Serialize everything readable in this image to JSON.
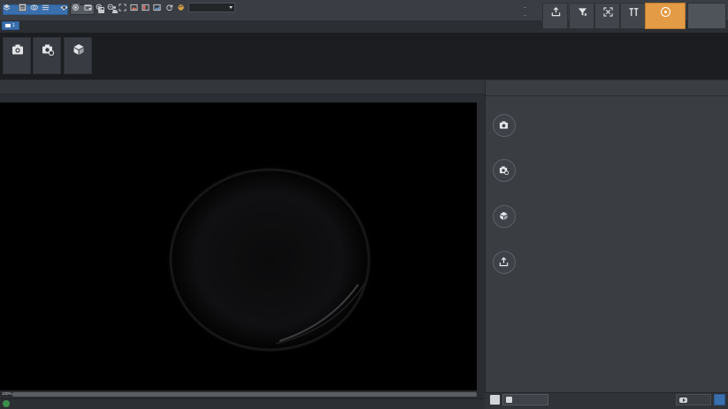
{
  "window": {
    "model_combo": "",
    "mode_combo": "",
    "user_path": ""
  },
  "timing": {
    "detect_label": "",
    "detect_value": "--",
    "output_label": "",
    "output_value": "--"
  },
  "toolbar": {
    "buttons": [
      {
        "label": "",
        "icon": "export-icon"
      },
      {
        "label": "",
        "icon": "filter-icon"
      },
      {
        "label": "",
        "icon": "position-correct-icon"
      },
      {
        "label": "",
        "icon": "text-tools-icon"
      }
    ],
    "active_button": {
      "label": "",
      "icon": "run-mode-icon"
    }
  },
  "tab": {
    "label": "1",
    "icon": "camera-icon"
  },
  "ribbon": {
    "buttons": [
      {
        "label": "",
        "icon": "camera-icon"
      },
      {
        "label": "",
        "icon": "camera-settings-icon"
      },
      {
        "label": "",
        "icon": "add-tool-icon"
      }
    ]
  },
  "image_toolbar": {
    "view_combo": ""
  },
  "image_tag": "",
  "zoom": "100%",
  "panel": {
    "title": "",
    "steps": [
      {
        "title": "",
        "desc": "",
        "icon": "camera-icon"
      },
      {
        "title": "",
        "desc": "",
        "icon": "camera-settings-icon"
      },
      {
        "title": "",
        "desc": "",
        "icon": "add-tool-icon"
      },
      {
        "title": "",
        "desc": "",
        "icon": "upload-icon"
      }
    ],
    "bottom_button": ""
  },
  "status": {
    "text": "",
    "position": "",
    "color": ""
  },
  "colors": {
    "accent_blue": "#3a6fae",
    "active_orange": "#e39b45",
    "status_green": "#3b8f4b"
  }
}
